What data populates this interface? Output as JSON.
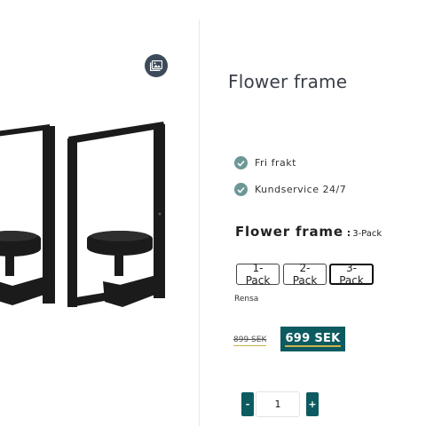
{
  "gallery": {
    "zoom_icon": "image-icon"
  },
  "product": {
    "title": "Flower frame",
    "usps": [
      {
        "icon": "check-circle-icon",
        "label": "Fri frakt"
      },
      {
        "icon": "check-circle-icon",
        "label": "Kundservice 24/7"
      }
    ],
    "variant": {
      "name": "Flower frame",
      "separator": ":",
      "selected": "3-Pack"
    },
    "pack_options": [
      {
        "label": "1-Pack",
        "selected": false
      },
      {
        "label": "2-Pack",
        "selected": false
      },
      {
        "label": "3-Pack",
        "selected": true
      }
    ],
    "clear_label": "Rensa",
    "old_price": "899 SEK",
    "price": "699 SEK",
    "quantity": {
      "minus": "-",
      "value": "1",
      "plus": "+"
    }
  },
  "colors": {
    "accent": "#0c5b61",
    "check": "#6b9896",
    "underline": "#c9b24a"
  }
}
